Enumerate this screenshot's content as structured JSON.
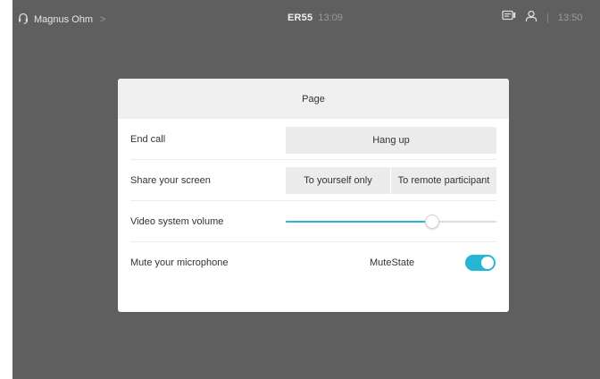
{
  "topbar": {
    "caller_name": "Magnus Ohm",
    "caller_chevron": ">",
    "system_name": "ER55",
    "call_time": "13:09",
    "separator": "|",
    "clock": "13:50"
  },
  "panel": {
    "title": "Page",
    "rows": {
      "end_call": {
        "label": "End call",
        "button": "Hang up"
      },
      "share_screen": {
        "label": "Share your screen",
        "option_self": "To yourself only",
        "option_remote": "To remote participant"
      },
      "volume": {
        "label": "Video system volume",
        "level_percent": 69
      },
      "mute": {
        "label": "Mute your microphone",
        "state_text": "MuteState",
        "toggle_on": true
      }
    }
  },
  "colors": {
    "accent": "#27b5d6",
    "backdrop": "#5f5f5f",
    "panel_header": "#f0f0f0",
    "button_bg": "#ececec"
  },
  "icons": {
    "caller": "headset-icon",
    "share": "screen-share-icon",
    "user": "user-icon"
  }
}
